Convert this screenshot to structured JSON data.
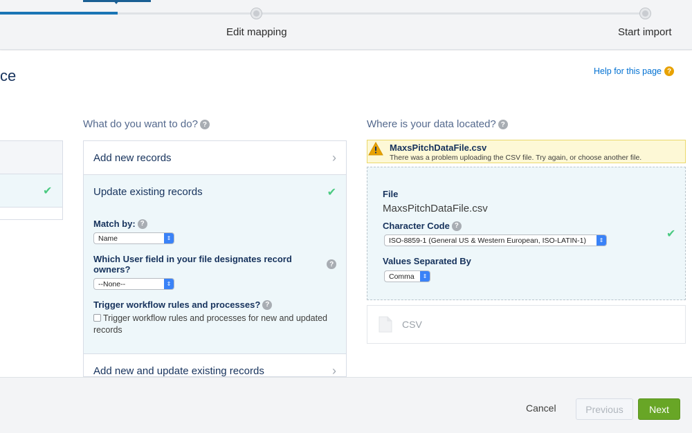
{
  "progress": {
    "steps": [
      {
        "label": "Edit mapping"
      },
      {
        "label": "Start import"
      }
    ]
  },
  "header": {
    "title_fragment": "ce",
    "help_link": "Help for this page",
    "help_icon": "?"
  },
  "action_section": {
    "heading": "What do you want to do?",
    "options": [
      {
        "label": "Add new records",
        "state": "collapsed"
      },
      {
        "label": "Update existing records",
        "state": "selected"
      },
      {
        "label": "Add new and update existing records",
        "state": "collapsed"
      }
    ],
    "match_by_label": "Match by:",
    "match_by_value": "Name",
    "owner_field_label": "Which User field in your file designates record owners?",
    "owner_field_value": "--None--",
    "trigger_label": "Trigger workflow rules and processes?",
    "trigger_checkbox_text": "Trigger workflow rules and processes for new and updated records",
    "trigger_checked": false
  },
  "data_section": {
    "heading": "Where is your data located?",
    "warning": {
      "title": "MaxsPitchDataFile.csv",
      "message": "There was a problem uploading the CSV file. Try again, or choose another file."
    },
    "file_label": "File",
    "file_value": "MaxsPitchDataFile.csv",
    "charcode_label": "Character Code",
    "charcode_value": "ISO-8859-1 (General US & Western European, ISO-LATIN-1)",
    "separator_label": "Values Separated By",
    "separator_value": "Comma",
    "source_option": "CSV"
  },
  "footer": {
    "cancel": "Cancel",
    "previous": "Previous",
    "next": "Next"
  },
  "colors": {
    "accent": "#1a75b5",
    "next_button": "#68a626",
    "check": "#4bca81",
    "warning": "#e8a202"
  }
}
